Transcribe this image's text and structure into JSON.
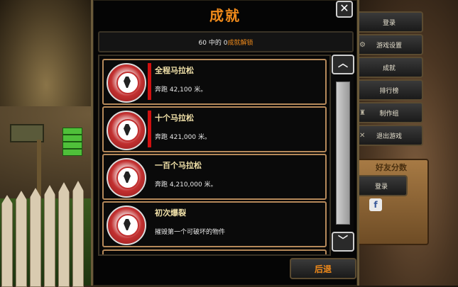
{
  "dialog": {
    "title": "成就",
    "summary_count": "60 中的 0",
    "summary_label": "成就解锁",
    "back_label": "后退"
  },
  "achievements": [
    {
      "title": "全程马拉松",
      "desc": "奔跑 42,100 米。"
    },
    {
      "title": "十个马拉松",
      "desc": "奔跑 421,000 米。"
    },
    {
      "title": "一百个马拉松",
      "desc": "奔跑 4,210,000 米。"
    },
    {
      "title": "初次爆裂",
      "desc": "摧毁第一个可破坏的物件"
    }
  ],
  "side_menu": {
    "items": [
      "登录",
      "游戏设置",
      "成就",
      "排行榜",
      "制作组",
      "退出游戏"
    ],
    "panel_title": "好友分数",
    "panel_login": "登录"
  },
  "colors": {
    "accent": "#f08a1a",
    "achievement_locked_bar": "#d01010",
    "item_border": "#b5895a"
  },
  "icons": {
    "close": "close-icon",
    "scroll_up": "chevron-up-icon",
    "scroll_down": "chevron-down-icon",
    "achievement": "achievement-medal-icon"
  }
}
